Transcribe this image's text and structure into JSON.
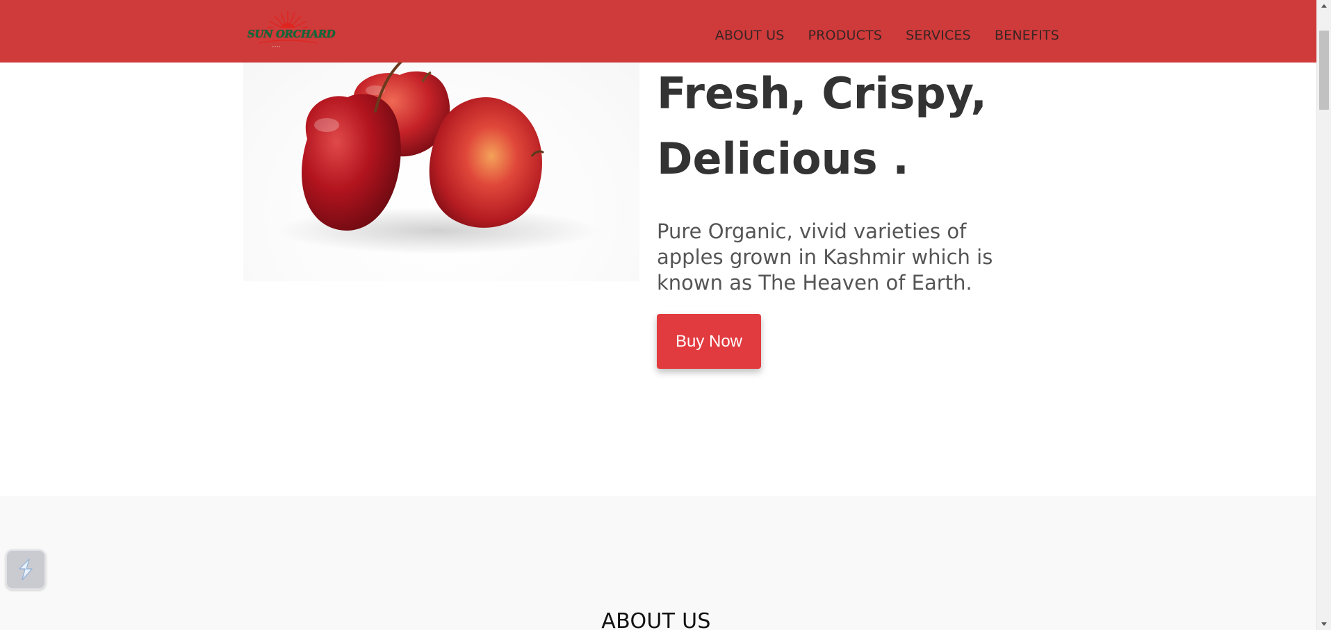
{
  "header": {
    "logo_text": "SUN ORCHARD",
    "background_color": "#cf3a3a",
    "nav": [
      {
        "label": "ABOUT US"
      },
      {
        "label": "PRODUCTS"
      },
      {
        "label": "SERVICES"
      },
      {
        "label": "BENEFITS"
      }
    ]
  },
  "hero": {
    "image": "apples-icon",
    "title_line1": "Fresh, Crispy,",
    "title_line2": "Delicious .",
    "description": "Pure Organic, vivid varieties of apples grown in Kashmir which is known as The Heaven of Earth.",
    "cta_label": "Buy Now",
    "cta_color": "#e23b3f"
  },
  "about": {
    "title": "ABOUT US"
  },
  "widget": {
    "icon": "lightning-widget-icon"
  }
}
